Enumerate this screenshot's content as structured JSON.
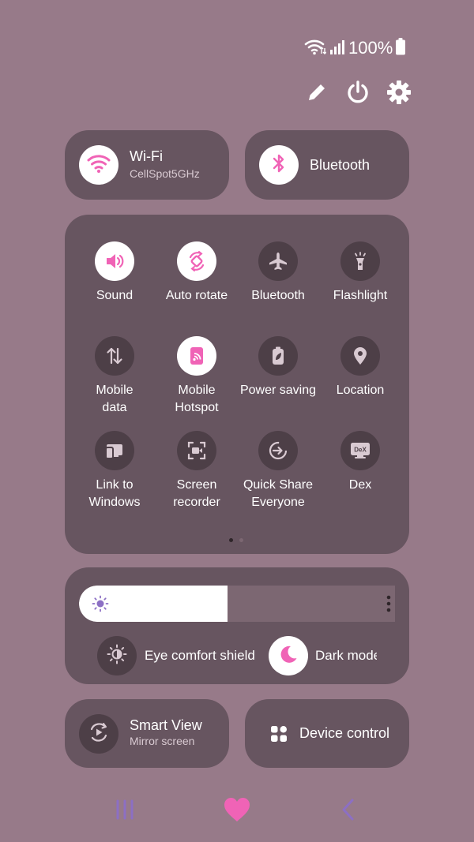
{
  "status_bar": {
    "battery_text": "100%"
  },
  "header_actions": [
    {
      "name": "edit-button",
      "icon": "pencil-icon"
    },
    {
      "name": "power-button",
      "icon": "power-icon"
    },
    {
      "name": "settings-button",
      "icon": "gear-icon"
    }
  ],
  "wifi": {
    "title": "Wi-Fi",
    "subtitle": "CellSpot5GHz",
    "icon": "wifi-icon",
    "on": true
  },
  "bluetooth_card": {
    "title": "Bluetooth",
    "icon": "bluetooth-icon",
    "on": true
  },
  "tiles": [
    {
      "label": "Sound",
      "icon": "speaker-icon",
      "on": true
    },
    {
      "label": "Auto rotate",
      "icon": "rotate-icon",
      "on": true
    },
    {
      "label": "Bluetooth",
      "icon": "airplane-icon",
      "on": false
    },
    {
      "label": "Flashlight",
      "icon": "flashlight-icon",
      "on": false
    },
    {
      "label": "Mobile\ndata",
      "icon": "mobile-data-icon",
      "on": false
    },
    {
      "label": "Mobile\nHotspot",
      "icon": "hotspot-icon",
      "on": true
    },
    {
      "label": "Power saving",
      "icon": "battery-leaf-icon",
      "on": false
    },
    {
      "label": "Location",
      "icon": "location-pin-icon",
      "on": false
    },
    {
      "label": "Link to\nWindows",
      "icon": "link-windows-icon",
      "on": false
    },
    {
      "label": "Screen\nrecorder",
      "icon": "screen-recorder-icon",
      "on": false
    },
    {
      "label": "Quick Share\nEveryone",
      "icon": "quick-share-icon",
      "on": false
    },
    {
      "label": "Dex",
      "icon": "dex-icon",
      "on": false
    }
  ],
  "pager": {
    "total": 2,
    "current": 1
  },
  "brightness": {
    "level": 0.47,
    "icon": "sun-icon"
  },
  "eye_comfort": {
    "label": "Eye comfort shield",
    "icon": "eye-comfort-icon",
    "on": false
  },
  "dark_mode": {
    "label": "Dark mode",
    "icon": "moon-icon",
    "on": true
  },
  "smart_view": {
    "title": "Smart View",
    "subtitle": "Mirror screen",
    "icon": "smart-view-icon"
  },
  "device_control": {
    "title": "Device control",
    "icon": "grid-dots-icon"
  },
  "navigation": [
    {
      "name": "recent-apps-button",
      "icon": "recents-icon"
    },
    {
      "name": "home-button",
      "icon": "heart-icon"
    },
    {
      "name": "back-button",
      "icon": "back-chevron-icon"
    }
  ],
  "colors": {
    "background": "#977a89",
    "panel": "#675560",
    "tile_off": "#4d3f47",
    "accent": "#f063b6",
    "nav_purple": "#8c6fc4"
  }
}
